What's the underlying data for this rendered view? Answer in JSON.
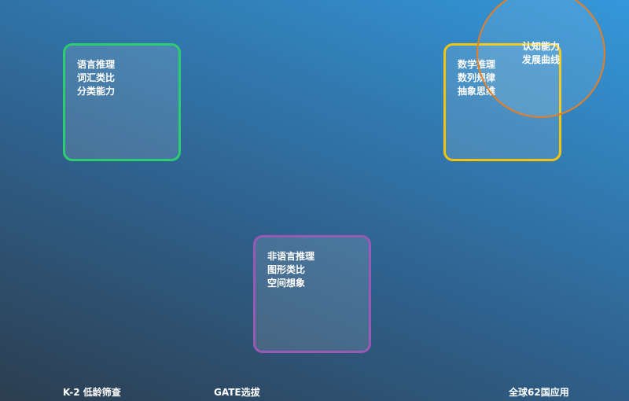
{
  "colors": {
    "verbal_border": "#2ecc71",
    "quantitative_border": "#f1c40f",
    "nonverbal_border": "#9b59b6",
    "circle_border": "#e67e22",
    "text": "#ffffff"
  },
  "boxes": {
    "verbal": {
      "lines": [
        "语言推理",
        "词汇类比",
        "分类能力"
      ]
    },
    "quantitative": {
      "lines": [
        "数学推理",
        "数列规律",
        "抽象思维"
      ]
    },
    "nonverbal": {
      "lines": [
        "非语言推理",
        "图形类比",
        "空间想象"
      ]
    }
  },
  "circle": {
    "lines": [
      "认知能力",
      "发展曲线"
    ]
  },
  "footer": [
    "K-2 低龄筛查",
    "GATE选拔",
    "全球62国应用"
  ]
}
